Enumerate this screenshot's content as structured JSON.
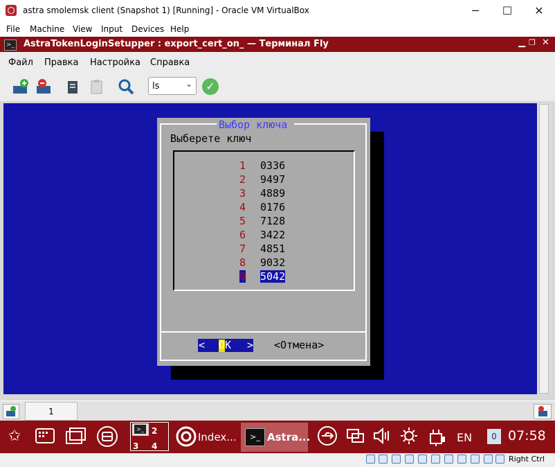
{
  "vbox": {
    "title": "astra smolemsk client (Snapshot 1) [Running] - Oracle VM VirtualBox",
    "minimize": "─",
    "maximize": "☐",
    "close": "✕",
    "menu": [
      "File",
      "Machine",
      "View",
      "Input",
      "Devices",
      "Help"
    ],
    "host_key": "Right Ctrl"
  },
  "terminal": {
    "title": "AstraTokenLoginSetupper : export_cert_on_ — Терминал Fly",
    "menu": [
      "Файл",
      "Правка",
      "Настройка",
      "Справка"
    ],
    "command_select": "ls",
    "tab_label": "1"
  },
  "dialog": {
    "title": "Выбор ключа",
    "prompt": "Выберете ключ",
    "items": [
      {
        "num": "1",
        "value": "0336"
      },
      {
        "num": "2",
        "value": "9497"
      },
      {
        "num": "3",
        "value": "4889"
      },
      {
        "num": "4",
        "value": "0176"
      },
      {
        "num": "5",
        "value": "7128"
      },
      {
        "num": "6",
        "value": "3422"
      },
      {
        "num": "7",
        "value": "4851"
      },
      {
        "num": "8",
        "value": "9032"
      },
      {
        "num": "9",
        "value": "5042"
      }
    ],
    "selected_index": 8,
    "ok_left": "<",
    "ok_label": "OK",
    "ok_right": ">",
    "cancel": "<Отмена>"
  },
  "taskbar": {
    "desktops": [
      "1",
      "2",
      "3",
      "4"
    ],
    "task_index": "Index...",
    "task_astra": "Astra...",
    "lang": "EN",
    "notifications": "0",
    "clock": "07:58"
  },
  "colors": {
    "fly_red": "#8b0f14",
    "terminal_blue": "#1414a8",
    "dialog_gray": "#aaaaaa"
  }
}
